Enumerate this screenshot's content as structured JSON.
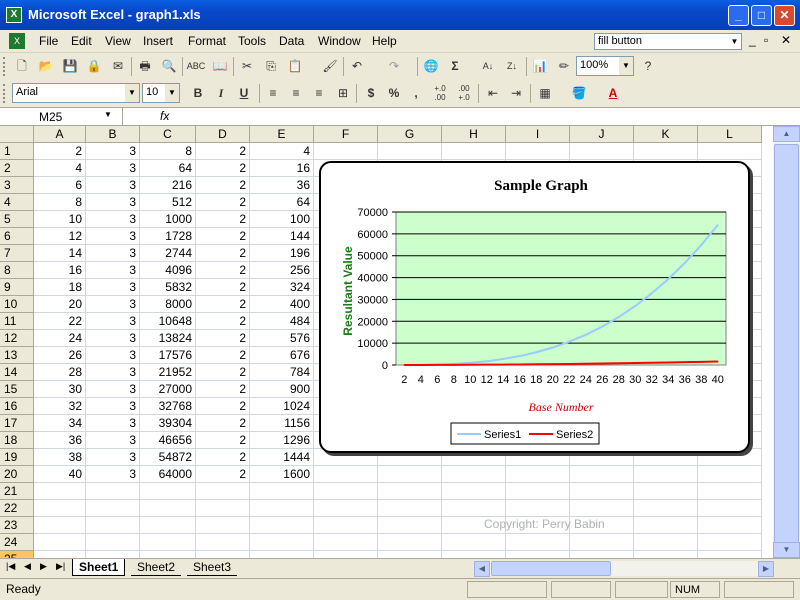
{
  "window": {
    "title": "Microsoft Excel - graph1.xls",
    "controls": {
      "minimize": "_",
      "maximize": "□",
      "close": "✕"
    }
  },
  "menu": {
    "items": [
      "File",
      "Edit",
      "View",
      "Insert",
      "Format",
      "Tools",
      "Data",
      "Window",
      "Help"
    ],
    "help_box": "fill button",
    "doc_controls": [
      "_",
      "▫",
      "✕"
    ]
  },
  "toolbar": {
    "zoom": "100%",
    "font": "Arial",
    "font_size": "10",
    "bold": "B",
    "italic": "I",
    "underline": "U",
    "currency": "$",
    "percent": "%",
    "comma": ",",
    "inc_decimal": "+.0\n.00",
    "dec_decimal": ".00\n+.0"
  },
  "formula_bar": {
    "name_box": "M25",
    "fx": "fx",
    "formula": ""
  },
  "columns": [
    "A",
    "B",
    "C",
    "D",
    "E",
    "F",
    "G",
    "H",
    "I",
    "J",
    "K",
    "L"
  ],
  "rows": [
    "1",
    "2",
    "3",
    "4",
    "5",
    "6",
    "7",
    "8",
    "9",
    "10",
    "11",
    "12",
    "13",
    "14",
    "15",
    "16",
    "17",
    "18",
    "19",
    "20",
    "21",
    "22",
    "23",
    "24",
    "25"
  ],
  "cells": [
    [
      "2",
      "3",
      "8",
      "2",
      "4"
    ],
    [
      "4",
      "3",
      "64",
      "2",
      "16"
    ],
    [
      "6",
      "3",
      "216",
      "2",
      "36"
    ],
    [
      "8",
      "3",
      "512",
      "2",
      "64"
    ],
    [
      "10",
      "3",
      "1000",
      "2",
      "100"
    ],
    [
      "12",
      "3",
      "1728",
      "2",
      "144"
    ],
    [
      "14",
      "3",
      "2744",
      "2",
      "196"
    ],
    [
      "16",
      "3",
      "4096",
      "2",
      "256"
    ],
    [
      "18",
      "3",
      "5832",
      "2",
      "324"
    ],
    [
      "20",
      "3",
      "8000",
      "2",
      "400"
    ],
    [
      "22",
      "3",
      "10648",
      "2",
      "484"
    ],
    [
      "24",
      "3",
      "13824",
      "2",
      "576"
    ],
    [
      "26",
      "3",
      "17576",
      "2",
      "676"
    ],
    [
      "28",
      "3",
      "21952",
      "2",
      "784"
    ],
    [
      "30",
      "3",
      "27000",
      "2",
      "900"
    ],
    [
      "32",
      "3",
      "32768",
      "2",
      "1024"
    ],
    [
      "34",
      "3",
      "39304",
      "2",
      "1156"
    ],
    [
      "36",
      "3",
      "46656",
      "2",
      "1296"
    ],
    [
      "38",
      "3",
      "54872",
      "2",
      "1444"
    ],
    [
      "40",
      "3",
      "64000",
      "2",
      "1600"
    ]
  ],
  "chart_data": {
    "type": "line",
    "title": "Sample Graph",
    "xlabel": "Base Number",
    "ylabel": "Resultant Value",
    "categories": [
      "2",
      "4",
      "6",
      "8",
      "10",
      "12",
      "14",
      "16",
      "18",
      "20",
      "22",
      "24",
      "26",
      "28",
      "30",
      "32",
      "34",
      "36",
      "38",
      "40"
    ],
    "yticks": [
      "0",
      "10000",
      "20000",
      "30000",
      "40000",
      "50000",
      "60000",
      "70000"
    ],
    "ylim": [
      0,
      70000
    ],
    "series": [
      {
        "name": "Series1",
        "color": "#99ccff",
        "values": [
          8,
          64,
          216,
          512,
          1000,
          1728,
          2744,
          4096,
          5832,
          8000,
          10648,
          13824,
          17576,
          21952,
          27000,
          32768,
          39304,
          46656,
          54872,
          64000
        ]
      },
      {
        "name": "Series2",
        "color": "#ff0000",
        "values": [
          4,
          16,
          36,
          64,
          100,
          144,
          196,
          256,
          324,
          400,
          484,
          576,
          676,
          784,
          900,
          1024,
          1156,
          1296,
          1444,
          1600
        ]
      }
    ],
    "legend": "bottom",
    "grid": true,
    "plot_bg": "#ccffcc"
  },
  "copyright": "Copyright: Perry Babin",
  "sheets": [
    "Sheet1",
    "Sheet2",
    "Sheet3"
  ],
  "active_sheet": "Sheet1",
  "status": {
    "text": "Ready",
    "num": "NUM"
  }
}
